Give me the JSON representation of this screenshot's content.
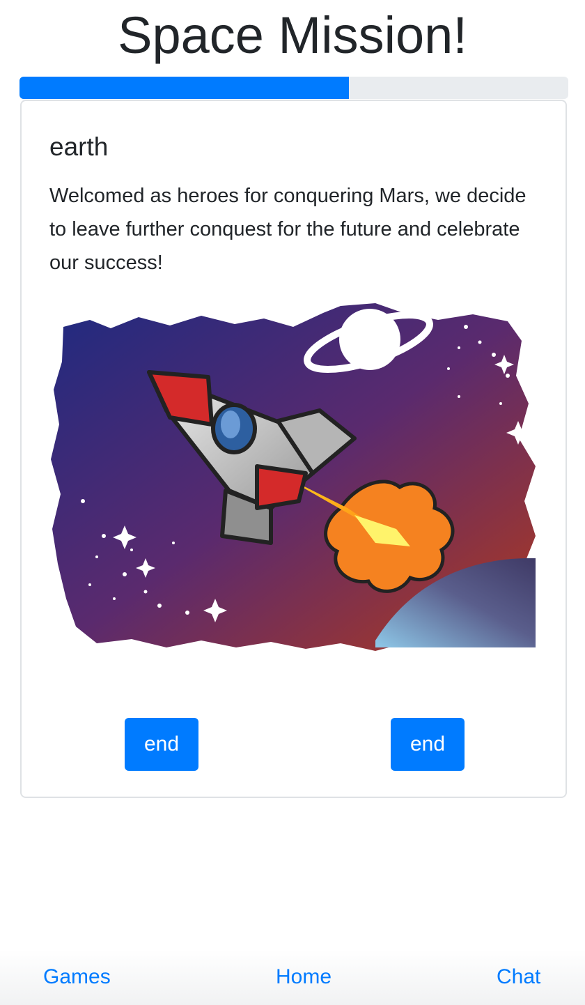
{
  "header": {
    "title": "Space Mission!"
  },
  "progress": {
    "percent": 60,
    "color": "#007bff"
  },
  "card": {
    "title": "earth",
    "text": "Welcomed as heroes for conquering Mars, we decide to leave further conquest for the future and celebrate our success!",
    "image": {
      "subject": "rocket-launch-illustration",
      "colors": {
        "bg_start": "#1f2a80",
        "bg_mid": "#5a2a6e",
        "bg_end": "#b23a1c"
      }
    },
    "choices": [
      {
        "label": "end"
      },
      {
        "label": "end"
      }
    ]
  },
  "nav": {
    "items": [
      {
        "label": "Games"
      },
      {
        "label": "Home"
      },
      {
        "label": "Chat"
      }
    ]
  }
}
